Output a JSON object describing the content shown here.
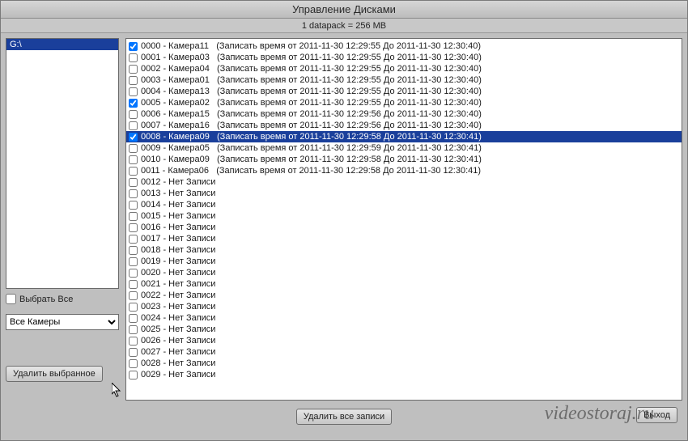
{
  "title": "Управление Дисками",
  "info": "1 datapack = 256 MB",
  "sidebar": {
    "drives": [
      "G:\\"
    ],
    "select_all_label": "Выбрать Все",
    "select_all_checked": false,
    "camera_filter": "Все Камеры",
    "delete_selected_label": "Удалить выбранное"
  },
  "footer": {
    "delete_all_label": "Удалить все записи",
    "exit_label": "Выход"
  },
  "watermark": "videostoraj.ru",
  "rows": [
    {
      "id": "0000",
      "checked": true,
      "name": "Камера11",
      "detail": "(Записать время от 2011-11-30 12:29:55 До 2011-11-30 12:30:40)",
      "selected": false
    },
    {
      "id": "0001",
      "checked": false,
      "name": "Камера03",
      "detail": "(Записать время от 2011-11-30 12:29:55 До 2011-11-30 12:30:40)",
      "selected": false
    },
    {
      "id": "0002",
      "checked": false,
      "name": "Камера04",
      "detail": "(Записать время от 2011-11-30 12:29:55 До 2011-11-30 12:30:40)",
      "selected": false
    },
    {
      "id": "0003",
      "checked": false,
      "name": "Камера01",
      "detail": "(Записать время от 2011-11-30 12:29:55 До 2011-11-30 12:30:40)",
      "selected": false
    },
    {
      "id": "0004",
      "checked": false,
      "name": "Камера13",
      "detail": "(Записать время от 2011-11-30 12:29:55 До 2011-11-30 12:30:40)",
      "selected": false
    },
    {
      "id": "0005",
      "checked": true,
      "name": "Камера02",
      "detail": "(Записать время от 2011-11-30 12:29:55 До 2011-11-30 12:30:40)",
      "selected": false
    },
    {
      "id": "0006",
      "checked": false,
      "name": "Камера15",
      "detail": "(Записать время от 2011-11-30 12:29:56 До 2011-11-30 12:30:40)",
      "selected": false
    },
    {
      "id": "0007",
      "checked": false,
      "name": "Камера16",
      "detail": "(Записать время от 2011-11-30 12:29:56 До 2011-11-30 12:30:40)",
      "selected": false
    },
    {
      "id": "0008",
      "checked": true,
      "name": "Камера09",
      "detail": "(Записать время от 2011-11-30 12:29:58 До 2011-11-30 12:30:41)",
      "selected": true
    },
    {
      "id": "0009",
      "checked": false,
      "name": "Камера05",
      "detail": "(Записать время от 2011-11-30 12:29:59 До 2011-11-30 12:30:41)",
      "selected": false
    },
    {
      "id": "0010",
      "checked": false,
      "name": "Камера09",
      "detail": "(Записать время от 2011-11-30 12:29:58 До 2011-11-30 12:30:41)",
      "selected": false
    },
    {
      "id": "0011",
      "checked": false,
      "name": "Камера06",
      "detail": "(Записать время от 2011-11-30 12:29:58 До 2011-11-30 12:30:41)",
      "selected": false
    },
    {
      "id": "0012",
      "checked": false,
      "name": "Нет Записи",
      "detail": "",
      "selected": false
    },
    {
      "id": "0013",
      "checked": false,
      "name": "Нет Записи",
      "detail": "",
      "selected": false
    },
    {
      "id": "0014",
      "checked": false,
      "name": "Нет Записи",
      "detail": "",
      "selected": false
    },
    {
      "id": "0015",
      "checked": false,
      "name": "Нет Записи",
      "detail": "",
      "selected": false
    },
    {
      "id": "0016",
      "checked": false,
      "name": "Нет Записи",
      "detail": "",
      "selected": false
    },
    {
      "id": "0017",
      "checked": false,
      "name": "Нет Записи",
      "detail": "",
      "selected": false
    },
    {
      "id": "0018",
      "checked": false,
      "name": "Нет Записи",
      "detail": "",
      "selected": false
    },
    {
      "id": "0019",
      "checked": false,
      "name": "Нет Записи",
      "detail": "",
      "selected": false
    },
    {
      "id": "0020",
      "checked": false,
      "name": "Нет Записи",
      "detail": "",
      "selected": false
    },
    {
      "id": "0021",
      "checked": false,
      "name": "Нет Записи",
      "detail": "",
      "selected": false
    },
    {
      "id": "0022",
      "checked": false,
      "name": "Нет Записи",
      "detail": "",
      "selected": false
    },
    {
      "id": "0023",
      "checked": false,
      "name": "Нет Записи",
      "detail": "",
      "selected": false
    },
    {
      "id": "0024",
      "checked": false,
      "name": "Нет Записи",
      "detail": "",
      "selected": false
    },
    {
      "id": "0025",
      "checked": false,
      "name": "Нет Записи",
      "detail": "",
      "selected": false
    },
    {
      "id": "0026",
      "checked": false,
      "name": "Нет Записи",
      "detail": "",
      "selected": false
    },
    {
      "id": "0027",
      "checked": false,
      "name": "Нет Записи",
      "detail": "",
      "selected": false
    },
    {
      "id": "0028",
      "checked": false,
      "name": "Нет Записи",
      "detail": "",
      "selected": false
    },
    {
      "id": "0029",
      "checked": false,
      "name": "Нет Записи",
      "detail": "",
      "selected": false
    }
  ]
}
